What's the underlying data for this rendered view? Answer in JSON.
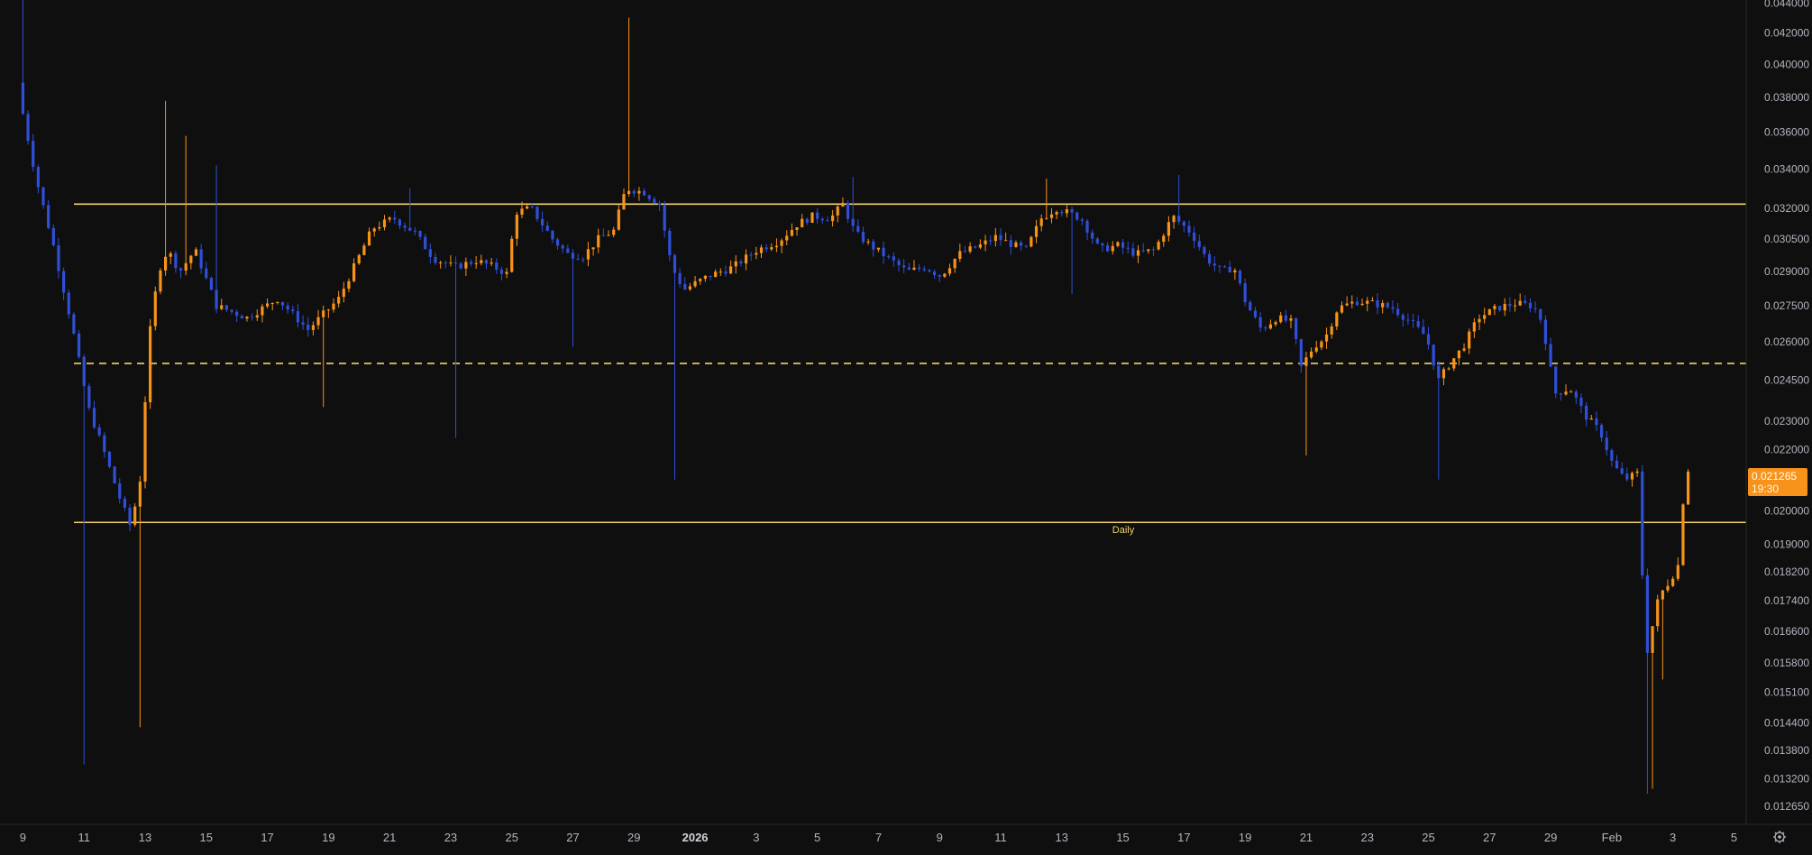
{
  "chart_data": {
    "type": "candlestick",
    "title": "",
    "colors": {
      "background": "#0f0f0f",
      "up": "#f7931a",
      "down": "#2f4fd8",
      "level_line": "#f4d36b",
      "axis_text": "#b2b5be",
      "price_tag": "#f7931a"
    },
    "y_axis": {
      "side": "right",
      "ticks": [
        "0.044000",
        "0.042000",
        "0.040000",
        "0.038000",
        "0.036000",
        "0.034000",
        "0.032000",
        "0.030500",
        "0.029000",
        "0.027500",
        "0.026000",
        "0.024500",
        "0.023000",
        "0.022000",
        "0.020000",
        "0.019000",
        "0.018200",
        "0.017400",
        "0.016600",
        "0.015800",
        "0.015100",
        "0.014400",
        "0.013800",
        "0.013200",
        "0.012650"
      ],
      "scale": "log",
      "ylim": [
        0.0123,
        0.0442
      ]
    },
    "x_axis": {
      "ticks": [
        {
          "label": "9",
          "bold": false
        },
        {
          "label": "11",
          "bold": false
        },
        {
          "label": "13",
          "bold": false
        },
        {
          "label": "15",
          "bold": false
        },
        {
          "label": "17",
          "bold": false
        },
        {
          "label": "19",
          "bold": false
        },
        {
          "label": "21",
          "bold": false
        },
        {
          "label": "23",
          "bold": false
        },
        {
          "label": "25",
          "bold": false
        },
        {
          "label": "27",
          "bold": false
        },
        {
          "label": "29",
          "bold": false
        },
        {
          "label": "2026",
          "bold": true
        },
        {
          "label": "3",
          "bold": false
        },
        {
          "label": "5",
          "bold": false
        },
        {
          "label": "7",
          "bold": false
        },
        {
          "label": "9",
          "bold": false
        },
        {
          "label": "11",
          "bold": false
        },
        {
          "label": "13",
          "bold": false
        },
        {
          "label": "15",
          "bold": false
        },
        {
          "label": "17",
          "bold": false
        },
        {
          "label": "19",
          "bold": false
        },
        {
          "label": "21",
          "bold": false
        },
        {
          "label": "23",
          "bold": false
        },
        {
          "label": "25",
          "bold": false
        },
        {
          "label": "27",
          "bold": false
        },
        {
          "label": "29",
          "bold": false
        },
        {
          "label": "Feb",
          "bold": false
        },
        {
          "label": "3",
          "bold": false
        },
        {
          "label": "5",
          "bold": false
        }
      ],
      "xlim_days": [
        -0.75,
        56.4
      ]
    },
    "horizontal_levels": [
      {
        "price": 0.0322,
        "style": "solid",
        "label": ""
      },
      {
        "price": 0.02515,
        "style": "dashed",
        "label": ""
      },
      {
        "price": 0.01965,
        "style": "solid",
        "label": "Daily"
      }
    ],
    "current_price": {
      "value": "0.021265",
      "countdown": "19:30"
    },
    "anchors": [
      {
        "d": 0.0,
        "p": 0.0385
      },
      {
        "d": 0.6,
        "p": 0.0335
      },
      {
        "d": 1.2,
        "p": 0.03
      },
      {
        "d": 1.8,
        "p": 0.0265
      },
      {
        "d": 2.3,
        "p": 0.0235
      },
      {
        "d": 2.8,
        "p": 0.022
      },
      {
        "d": 3.3,
        "p": 0.0205
      },
      {
        "d": 3.7,
        "p": 0.0195
      },
      {
        "d": 4.0,
        "p": 0.021
      },
      {
        "d": 4.3,
        "p": 0.0262
      },
      {
        "d": 4.6,
        "p": 0.029
      },
      {
        "d": 4.9,
        "p": 0.03
      },
      {
        "d": 5.3,
        "p": 0.029
      },
      {
        "d": 5.8,
        "p": 0.03
      },
      {
        "d": 6.5,
        "p": 0.0275
      },
      {
        "d": 7.5,
        "p": 0.027
      },
      {
        "d": 8.5,
        "p": 0.0278
      },
      {
        "d": 9.5,
        "p": 0.0265
      },
      {
        "d": 10.5,
        "p": 0.0278
      },
      {
        "d": 11.0,
        "p": 0.0292
      },
      {
        "d": 11.6,
        "p": 0.031
      },
      {
        "d": 12.3,
        "p": 0.0315
      },
      {
        "d": 13.0,
        "p": 0.0308
      },
      {
        "d": 13.6,
        "p": 0.0296
      },
      {
        "d": 14.3,
        "p": 0.0292
      },
      {
        "d": 15.0,
        "p": 0.0295
      },
      {
        "d": 15.6,
        "p": 0.0292
      },
      {
        "d": 16.0,
        "p": 0.0289
      },
      {
        "d": 16.3,
        "p": 0.0318
      },
      {
        "d": 16.8,
        "p": 0.032
      },
      {
        "d": 17.5,
        "p": 0.0305
      },
      {
        "d": 18.0,
        "p": 0.0298
      },
      {
        "d": 18.5,
        "p": 0.0297
      },
      {
        "d": 19.0,
        "p": 0.0305
      },
      {
        "d": 19.5,
        "p": 0.0309
      },
      {
        "d": 19.9,
        "p": 0.033
      },
      {
        "d": 20.5,
        "p": 0.0328
      },
      {
        "d": 21.0,
        "p": 0.0322
      },
      {
        "d": 21.4,
        "p": 0.0292
      },
      {
        "d": 21.8,
        "p": 0.0282
      },
      {
        "d": 22.6,
        "p": 0.0288
      },
      {
        "d": 23.4,
        "p": 0.0292
      },
      {
        "d": 24.2,
        "p": 0.03
      },
      {
        "d": 24.9,
        "p": 0.0304
      },
      {
        "d": 25.5,
        "p": 0.0312
      },
      {
        "d": 26.0,
        "p": 0.0316
      },
      {
        "d": 26.6,
        "p": 0.0315
      },
      {
        "d": 27.0,
        "p": 0.0322
      },
      {
        "d": 27.4,
        "p": 0.0308
      },
      {
        "d": 27.9,
        "p": 0.0302
      },
      {
        "d": 28.5,
        "p": 0.0296
      },
      {
        "d": 29.1,
        "p": 0.029
      },
      {
        "d": 29.7,
        "p": 0.0292
      },
      {
        "d": 30.2,
        "p": 0.0288
      },
      {
        "d": 30.8,
        "p": 0.0298
      },
      {
        "d": 31.5,
        "p": 0.0302
      },
      {
        "d": 32.0,
        "p": 0.0306
      },
      {
        "d": 32.6,
        "p": 0.0302
      },
      {
        "d": 33.0,
        "p": 0.03
      },
      {
        "d": 33.5,
        "p": 0.0315
      },
      {
        "d": 34.0,
        "p": 0.032
      },
      {
        "d": 34.8,
        "p": 0.0315
      },
      {
        "d": 35.4,
        "p": 0.03
      },
      {
        "d": 36.0,
        "p": 0.0302
      },
      {
        "d": 36.6,
        "p": 0.0298
      },
      {
        "d": 37.2,
        "p": 0.03
      },
      {
        "d": 37.8,
        "p": 0.0316
      },
      {
        "d": 38.4,
        "p": 0.0308
      },
      {
        "d": 38.9,
        "p": 0.0296
      },
      {
        "d": 39.4,
        "p": 0.029
      },
      {
        "d": 39.8,
        "p": 0.0292
      },
      {
        "d": 40.2,
        "p": 0.0276
      },
      {
        "d": 40.7,
        "p": 0.0265
      },
      {
        "d": 41.2,
        "p": 0.027
      },
      {
        "d": 41.7,
        "p": 0.0268
      },
      {
        "d": 42.0,
        "p": 0.025
      },
      {
        "d": 42.4,
        "p": 0.0258
      },
      {
        "d": 42.8,
        "p": 0.0262
      },
      {
        "d": 43.2,
        "p": 0.0274
      },
      {
        "d": 43.8,
        "p": 0.0277
      },
      {
        "d": 44.4,
        "p": 0.0276
      },
      {
        "d": 45.0,
        "p": 0.0274
      },
      {
        "d": 45.6,
        "p": 0.0268
      },
      {
        "d": 46.1,
        "p": 0.0262
      },
      {
        "d": 46.5,
        "p": 0.0245
      },
      {
        "d": 46.9,
        "p": 0.0252
      },
      {
        "d": 47.3,
        "p": 0.0258
      },
      {
        "d": 47.8,
        "p": 0.027
      },
      {
        "d": 48.4,
        "p": 0.0274
      },
      {
        "d": 49.0,
        "p": 0.0276
      },
      {
        "d": 49.6,
        "p": 0.0275
      },
      {
        "d": 49.9,
        "p": 0.0268
      },
      {
        "d": 50.3,
        "p": 0.024
      },
      {
        "d": 50.8,
        "p": 0.0242
      },
      {
        "d": 51.3,
        "p": 0.0232
      },
      {
        "d": 51.8,
        "p": 0.0226
      },
      {
        "d": 52.2,
        "p": 0.0215
      },
      {
        "d": 52.6,
        "p": 0.021
      },
      {
        "d": 53.0,
        "p": 0.0212
      },
      {
        "d": 53.3,
        "p": 0.016
      },
      {
        "d": 53.7,
        "p": 0.0175
      },
      {
        "d": 54.1,
        "p": 0.018
      },
      {
        "d": 54.4,
        "p": 0.0185
      },
      {
        "d": 54.55,
        "p": 0.021265
      }
    ],
    "spikes": [
      {
        "d": 0.0,
        "hi": 0.045
      },
      {
        "d": 2.0,
        "lo": 0.0135
      },
      {
        "d": 3.9,
        "lo": 0.0143
      },
      {
        "d": 4.7,
        "hi": 0.0378
      },
      {
        "d": 5.3,
        "hi": 0.0358
      },
      {
        "d": 6.3,
        "hi": 0.0342
      },
      {
        "d": 9.9,
        "lo": 0.0235
      },
      {
        "d": 12.7,
        "hi": 0.033
      },
      {
        "d": 14.1,
        "lo": 0.0224
      },
      {
        "d": 19.9,
        "hi": 0.043
      },
      {
        "d": 18.0,
        "lo": 0.0258
      },
      {
        "d": 21.4,
        "lo": 0.021
      },
      {
        "d": 33.5,
        "hi": 0.0335
      },
      {
        "d": 34.3,
        "lo": 0.028
      },
      {
        "d": 37.9,
        "hi": 0.0337
      },
      {
        "d": 27.1,
        "hi": 0.0336
      },
      {
        "d": 42.0,
        "lo": 0.0218
      },
      {
        "d": 46.4,
        "lo": 0.021
      },
      {
        "d": 53.1,
        "lo": 0.0129
      },
      {
        "d": 53.3,
        "lo": 0.013
      },
      {
        "d": 53.6,
        "lo": 0.0154
      }
    ]
  }
}
